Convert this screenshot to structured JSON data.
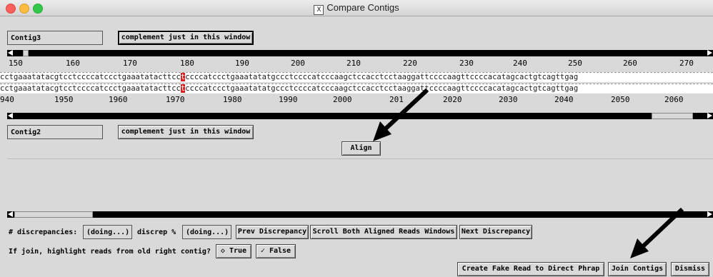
{
  "window": {
    "title": "Compare Contigs"
  },
  "top": {
    "contig_name": "Contig3",
    "complement_label": "complement just in this window",
    "ruler": [
      "150",
      "160",
      "170",
      "180",
      "190",
      "200",
      "210",
      "220",
      "230",
      "240",
      "250",
      "260",
      "270"
    ],
    "seq_pre": "cctgaaatatacgtcctccccatccctgaaatatacttcc",
    "seq_hl": "t",
    "seq_post": "ccccatccctgaaatatatgccctccccatcccaagctccacctcctaaggattccccaagttccccacatagcactgtcagttgag"
  },
  "bottom": {
    "seq_pre": "cctgaaatatacgtcctccccatccctgaaatatacttcc",
    "seq_hl": "t",
    "seq_post": "ccccatccctgaaatatatgccctccccatcccaagctccacctcctaaggattccccaagttccccacatagcactgtcagttgag",
    "ruler": [
      "940",
      "1950",
      "1960",
      "1970",
      "1980",
      "1990",
      "2000",
      "201",
      "2020",
      "2030",
      "2040",
      "2050",
      "2060"
    ],
    "contig_name": "Contig2",
    "complement_label": "complement just in this window"
  },
  "align_label": "Align",
  "discrep": {
    "label": "# discrepancies:",
    "value": "(doing...)",
    "pct_label": "discrep %",
    "pct_value": "(doing...)",
    "prev": "Prev Discrepancy",
    "scroll_both": "Scroll Both Aligned Reads Windows",
    "next": "Next Discrepancy"
  },
  "join": {
    "question": "If join, highlight reads from old right contig?",
    "true_label": "True",
    "false_label": "False"
  },
  "actions": {
    "fake_read": "Create Fake Read to Direct Phrap",
    "join_contigs": "Join Contigs",
    "dismiss": "Dismiss"
  }
}
